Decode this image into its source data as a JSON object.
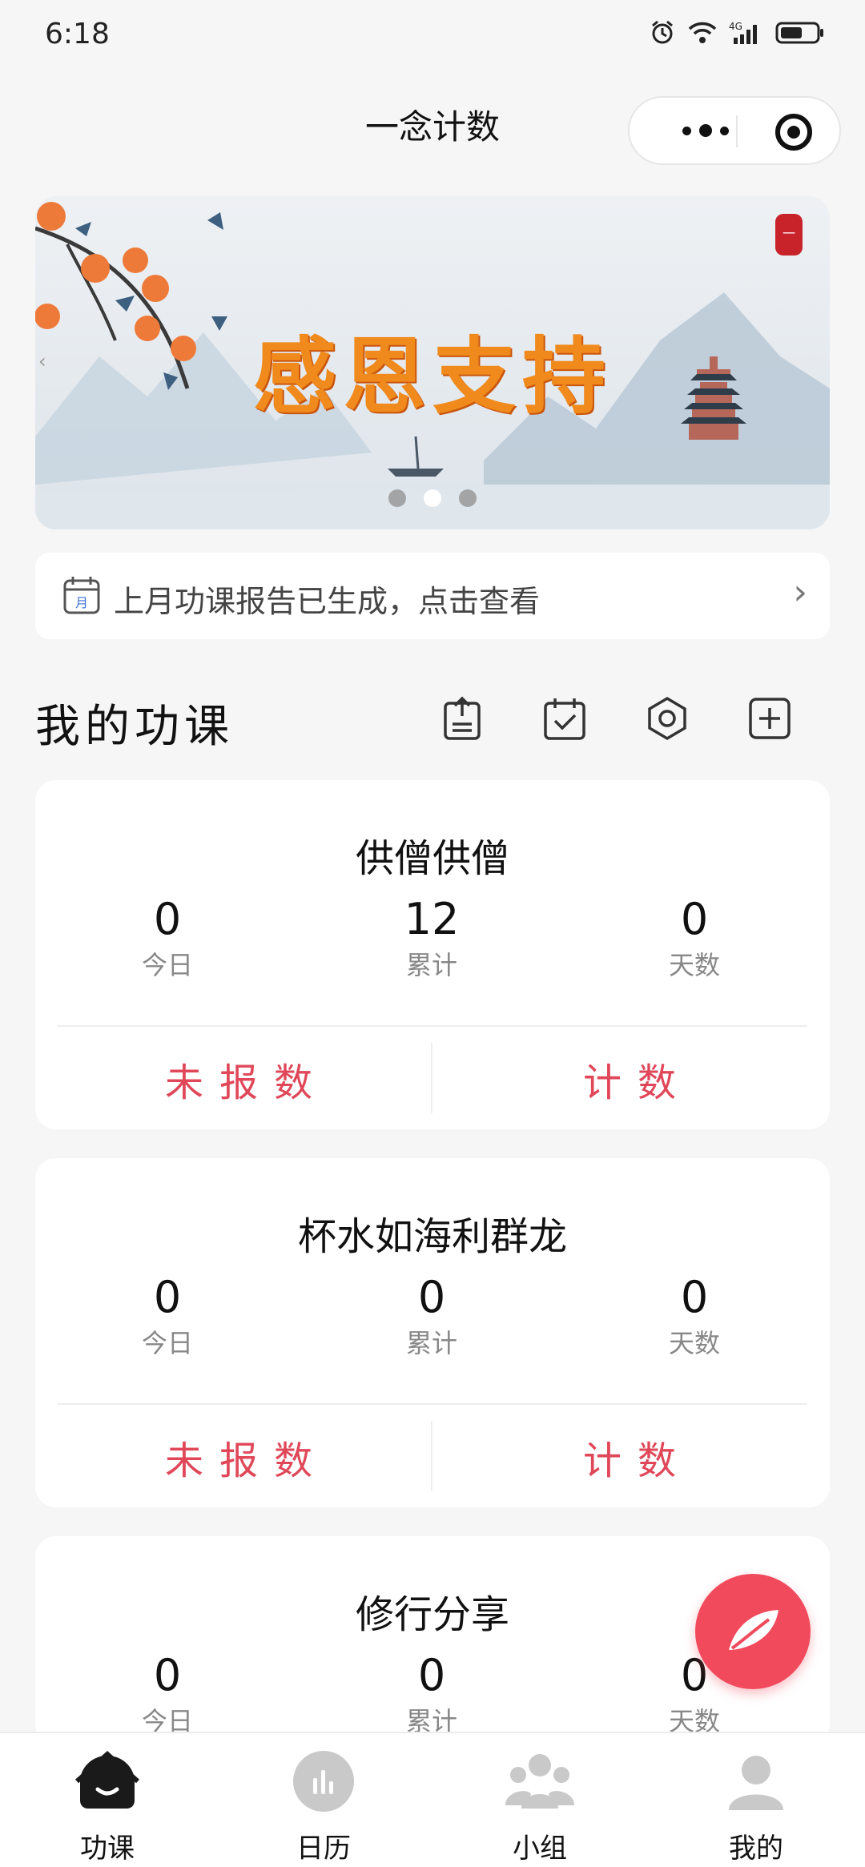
{
  "status_bar": {
    "time": "6:18"
  },
  "nav": {
    "title": "一念计数"
  },
  "banner": {
    "text": "感恩支持"
  },
  "report": {
    "text": "上月功课报告已生成，点击查看"
  },
  "section": {
    "title": "我的功课"
  },
  "cards": [
    {
      "title": "供僧供僧",
      "today": "0",
      "total": "12",
      "days": "0",
      "today_label": "今日",
      "total_label": "累计",
      "days_label": "天数",
      "report_btn": "未报数",
      "count_btn": "计数"
    },
    {
      "title": "杯水如海利群龙",
      "today": "0",
      "total": "0",
      "days": "0",
      "today_label": "今日",
      "total_label": "累计",
      "days_label": "天数",
      "report_btn": "未报数",
      "count_btn": "计数"
    },
    {
      "title": "修行分享",
      "today": "0",
      "total": "0",
      "days": "0",
      "today_label": "今日",
      "total_label": "累计",
      "days_label": "天数"
    }
  ],
  "tabbar": {
    "items": [
      {
        "label": "功课",
        "icon": "home-icon"
      },
      {
        "label": "日历",
        "icon": "calendar-chart-icon"
      },
      {
        "label": "小组",
        "icon": "group-icon"
      },
      {
        "label": "我的",
        "icon": "profile-icon"
      }
    ]
  },
  "colors": {
    "accent": "#e0485a",
    "fab": "#f04a5c",
    "background": "#f6f6f6"
  }
}
